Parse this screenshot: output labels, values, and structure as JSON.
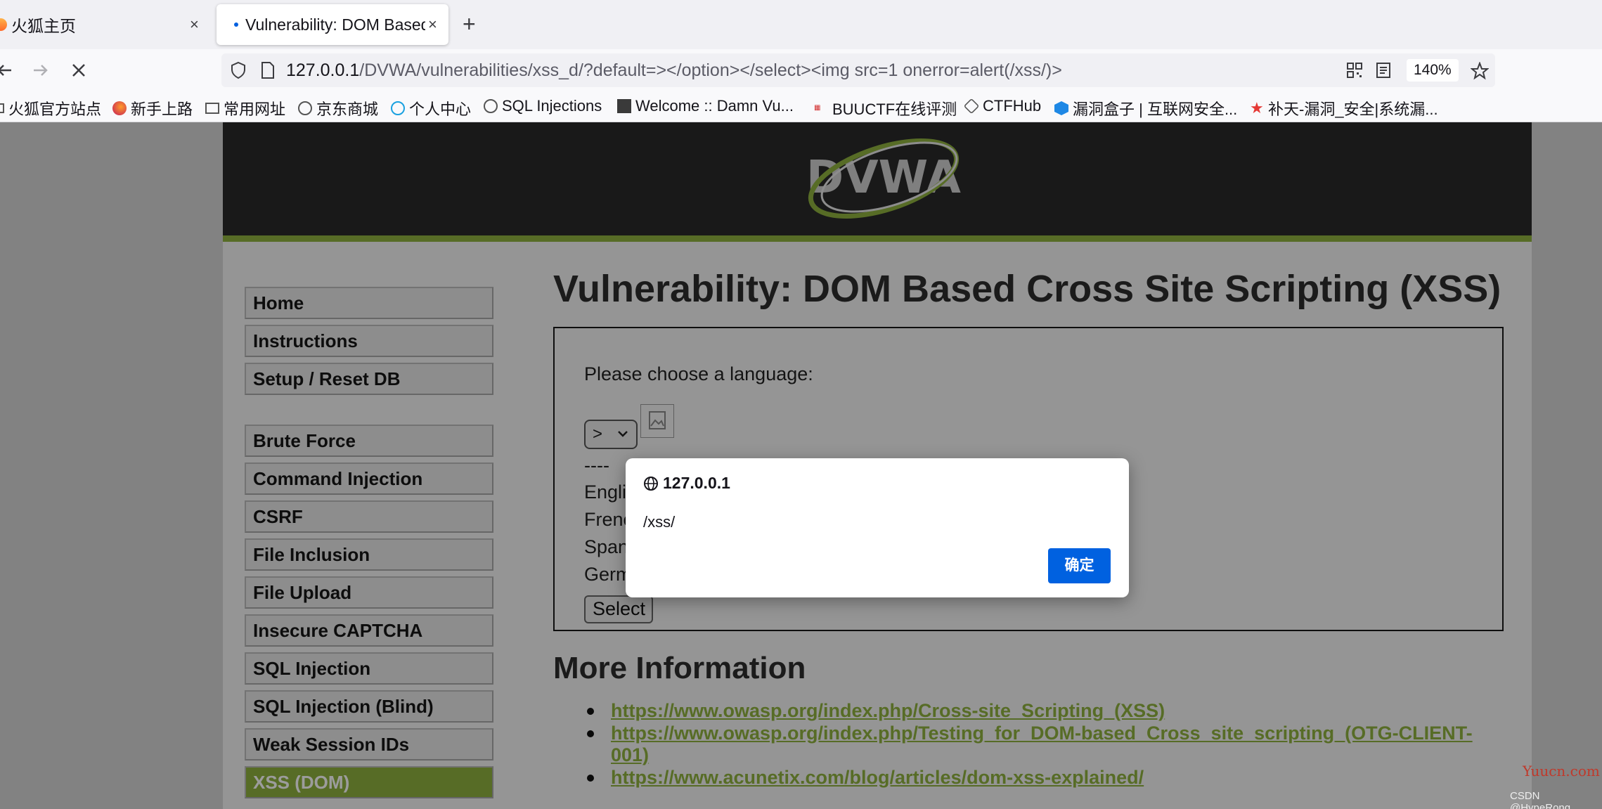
{
  "tabs": [
    {
      "title": "火狐主页"
    },
    {
      "title": "Vulnerability: DOM Based Cross Site Scripting (XSS)"
    }
  ],
  "newtab_symbol": "+",
  "tab_close_symbol": "×",
  "url": {
    "host": "127.0.0.1",
    "path": "/DVWA/vulnerabilities/xss_d/?default=></option></select><img src=1 onerror=alert(/xss/)>"
  },
  "zoom": "140%",
  "bookmarks": [
    "火狐官方站点",
    "新手上路",
    "常用网址",
    "京东商城",
    "个人中心",
    "SQL Injections",
    "Welcome :: Damn Vu...",
    "BUUCTF在线评测",
    "CTFHub",
    "漏洞盒子 | 互联网安全...",
    "补天-漏洞_安全|系统漏..."
  ],
  "menu": {
    "group1": [
      "Home",
      "Instructions",
      "Setup / Reset DB"
    ],
    "group2": [
      "Brute Force",
      "Command Injection",
      "CSRF",
      "File Inclusion",
      "File Upload",
      "Insecure CAPTCHA",
      "SQL Injection",
      "SQL Injection (Blind)",
      "Weak Session IDs"
    ],
    "active": "XSS (DOM)"
  },
  "page": {
    "title": "Vulnerability: DOM Based Cross Site Scripting (XSS)",
    "choose_language": "Please choose a language:",
    "select_value": ">",
    "separator": "----",
    "languages": [
      "English",
      "French",
      "Spanish",
      "German"
    ],
    "select_button": "Select",
    "more_info_title": "More Information",
    "links": [
      "https://www.owasp.org/index.php/Cross-site_Scripting_(XSS)",
      "https://www.owasp.org/index.php/Testing_for_DOM-based_Cross_site_scripting_(OTG-CLIENT-001)",
      "https://www.acunetix.com/blog/articles/dom-xss-explained/"
    ]
  },
  "dialog": {
    "origin": "127.0.0.1",
    "message": "/xss/",
    "ok_label": "确定"
  },
  "watermarks": [
    "Yuucn.com",
    "CSDN @HypeRong"
  ],
  "colors": {
    "accent": "#8eb13f",
    "button": "#0061e0"
  }
}
